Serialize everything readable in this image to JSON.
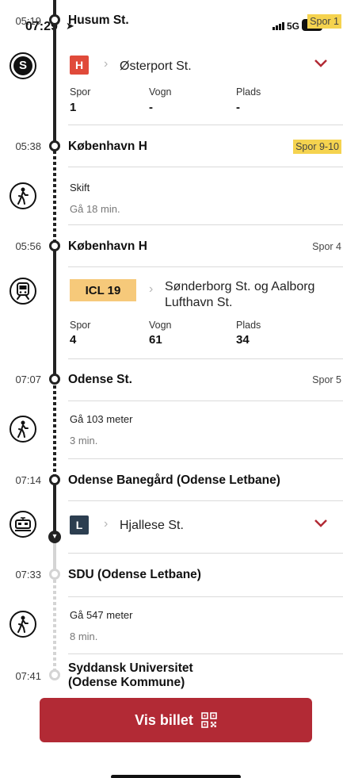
{
  "status_bar": {
    "time": "07:29",
    "network": "5G",
    "battery": "88"
  },
  "timeline": {
    "stop1": {
      "time": "05:19",
      "name": "Husum St.",
      "platform": "Spor 1"
    },
    "leg1": {
      "line": "H",
      "line_color": "#e04a3a",
      "destination": "Østerport St.",
      "spor_label": "Spor",
      "spor_value": "1",
      "vogn_label": "Vogn",
      "vogn_value": "-",
      "plads_label": "Plads",
      "plads_value": "-"
    },
    "stop2": {
      "time": "05:38",
      "name": "København H",
      "platform": "Spor 9-10"
    },
    "walk1": {
      "title": "Skift",
      "sub": "Gå 18 min."
    },
    "stop3": {
      "time": "05:56",
      "name": "København H",
      "platform": "Spor 4"
    },
    "leg2": {
      "line": "ICL 19",
      "line_color": "#f6c97a",
      "destination_line1": "Sønderborg St. og Aalborg",
      "destination_line2": "Lufthavn St.",
      "spor_label": "Spor",
      "spor_value": "4",
      "vogn_label": "Vogn",
      "vogn_value": "61",
      "plads_label": "Plads",
      "plads_value": "34"
    },
    "stop4": {
      "time": "07:07",
      "name": "Odense St.",
      "platform": "Spor 5"
    },
    "walk2": {
      "title": "Gå 103 meter",
      "sub": "3 min."
    },
    "stop5": {
      "time": "07:14",
      "name": "Odense Banegård (Odense Letbane)"
    },
    "leg3": {
      "line": "L",
      "line_color": "#2c3e50",
      "destination": "Hjallese St."
    },
    "stop6": {
      "time": "07:33",
      "name": "SDU (Odense Letbane)"
    },
    "walk3": {
      "title": "Gå 547 meter",
      "sub": "8 min."
    },
    "stop7": {
      "time": "07:41",
      "name_line1": "Syddansk Universitet",
      "name_line2": "(Odense Kommune)"
    }
  },
  "ticket_button": {
    "label": "Vis billet",
    "color": "#b22a35"
  }
}
